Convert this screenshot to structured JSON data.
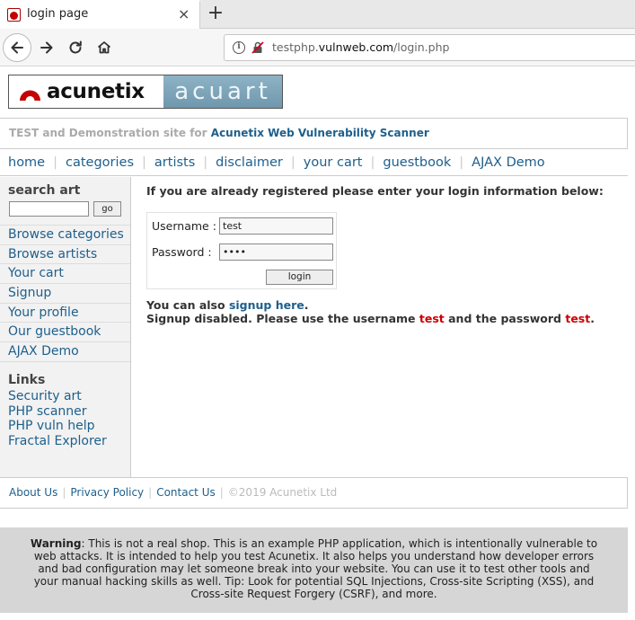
{
  "browser": {
    "tab_title": "login page",
    "tab_close": "×",
    "new_tab": "+",
    "url_prefix": "testphp.",
    "url_host": "vulnweb.com",
    "url_path": "/login.php"
  },
  "logo": {
    "left_word": "acunetix",
    "right_word": "acuart",
    "brand_red": "#c40000"
  },
  "tagline": {
    "muted": "TEST and Demonstration site for",
    "link": "Acunetix Web Vulnerability Scanner"
  },
  "menu": {
    "items": [
      "home",
      "categories",
      "artists",
      "disclaimer",
      "your cart",
      "guestbook",
      "AJAX Demo"
    ],
    "separator": "|"
  },
  "sidebar": {
    "search_heading": "search art",
    "search_value": "",
    "go_label": "go",
    "links": [
      "Browse categories",
      "Browse artists",
      "Your cart",
      "Signup",
      "Your profile",
      "Our guestbook",
      "AJAX Demo"
    ],
    "links_heading": "Links",
    "external": [
      "Security art",
      "PHP scanner",
      "PHP vuln help",
      "Fractal Explorer"
    ]
  },
  "login": {
    "lead": "If you are already registered please enter your login information below:",
    "username_label": "Username :",
    "username_value": "test",
    "password_label": "Password :",
    "password_value": "••••",
    "button": "login",
    "also_text": "You can also",
    "signup_link": "signup here",
    "period": ".",
    "disabled_text": "Signup disabled. Please use the username",
    "user": "test",
    "and_text": "and the password",
    "pass": "test"
  },
  "footer": {
    "links": [
      "About Us",
      "Privacy Policy",
      "Contact Us"
    ],
    "separator": "|",
    "copyright": "©2019 Acunetix Ltd"
  },
  "warning": {
    "label": "Warning",
    "text": ": This is not a real shop. This is an example PHP application, which is intentionally vulnerable to web attacks. It is intended to help you test Acunetix. It also helps you understand how developer errors and bad configuration may let someone break into your website. You can use it to test other tools and your manual hacking skills as well. Tip: Look for potential SQL Injections, Cross-site Scripting (XSS), and Cross-site Request Forgery (CSRF), and more."
  },
  "colors": {
    "link": "#1e5f8c",
    "highlight": "#cc0000",
    "sidebar_bg": "#f2f2f2",
    "warning_bg": "#d6d6d6"
  }
}
